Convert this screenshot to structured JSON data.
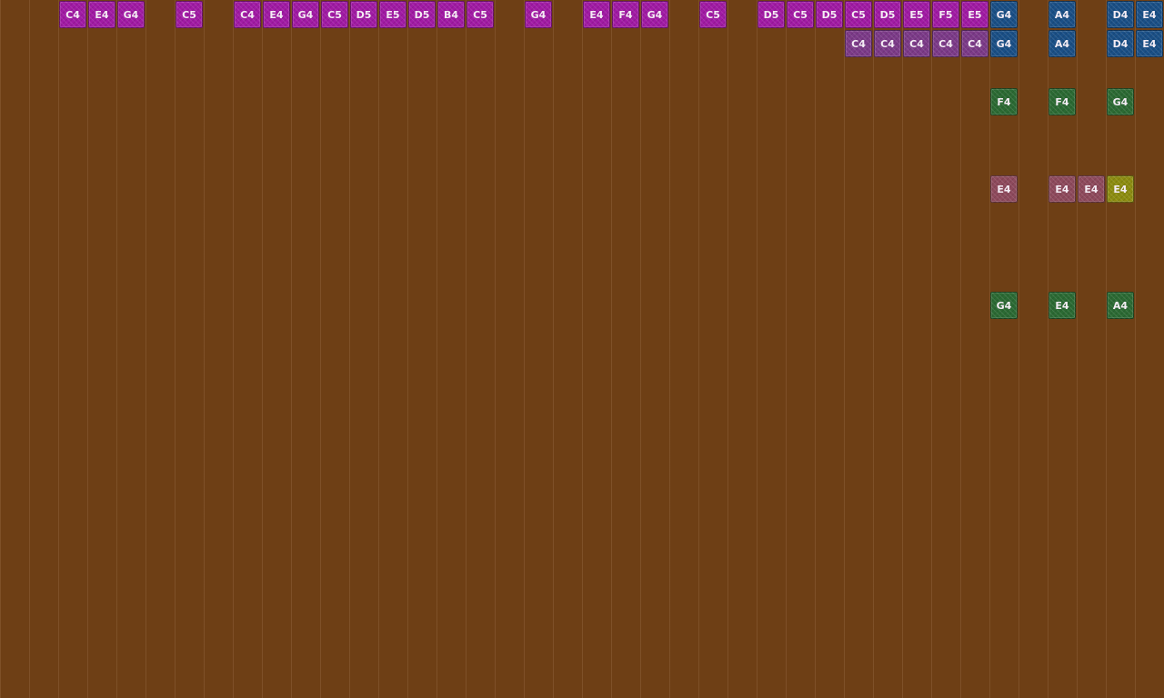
{
  "palette": {
    "background": "#6e3f15",
    "magenta": "#a11aa4",
    "purple": "#7c3a88",
    "blue": "#1a4f86",
    "green": "#2b6a33",
    "rose": "#8e4a5c",
    "olive": "#8c8c10"
  },
  "notes": [
    {
      "label": "C4",
      "color": "magenta",
      "col": 2,
      "row": 0
    },
    {
      "label": "E4",
      "color": "magenta",
      "col": 3,
      "row": 0
    },
    {
      "label": "G4",
      "color": "magenta",
      "col": 4,
      "row": 0
    },
    {
      "label": "C5",
      "color": "magenta",
      "col": 6,
      "row": 0
    },
    {
      "label": "C4",
      "color": "magenta",
      "col": 8,
      "row": 0
    },
    {
      "label": "E4",
      "color": "magenta",
      "col": 9,
      "row": 0
    },
    {
      "label": "G4",
      "color": "magenta",
      "col": 10,
      "row": 0
    },
    {
      "label": "C5",
      "color": "magenta",
      "col": 11,
      "row": 0
    },
    {
      "label": "D5",
      "color": "magenta",
      "col": 12,
      "row": 0
    },
    {
      "label": "E5",
      "color": "magenta",
      "col": 13,
      "row": 0
    },
    {
      "label": "D5",
      "color": "magenta",
      "col": 14,
      "row": 0
    },
    {
      "label": "B4",
      "color": "magenta",
      "col": 15,
      "row": 0
    },
    {
      "label": "C5",
      "color": "magenta",
      "col": 16,
      "row": 0
    },
    {
      "label": "G4",
      "color": "magenta",
      "col": 18,
      "row": 0
    },
    {
      "label": "E4",
      "color": "magenta",
      "col": 20,
      "row": 0
    },
    {
      "label": "F4",
      "color": "magenta",
      "col": 21,
      "row": 0
    },
    {
      "label": "G4",
      "color": "magenta",
      "col": 22,
      "row": 0
    },
    {
      "label": "C5",
      "color": "magenta",
      "col": 24,
      "row": 0
    },
    {
      "label": "D5",
      "color": "magenta",
      "col": 26,
      "row": 0
    },
    {
      "label": "C5",
      "color": "magenta",
      "col": 27,
      "row": 0
    },
    {
      "label": "D5",
      "color": "magenta",
      "col": 28,
      "row": 0
    },
    {
      "label": "C5",
      "color": "magenta",
      "col": 29,
      "row": 0
    },
    {
      "label": "D5",
      "color": "magenta",
      "col": 30,
      "row": 0
    },
    {
      "label": "E5",
      "color": "magenta",
      "col": 31,
      "row": 0
    },
    {
      "label": "F5",
      "color": "magenta",
      "col": 32,
      "row": 0
    },
    {
      "label": "E5",
      "color": "magenta",
      "col": 33,
      "row": 0
    },
    {
      "label": "G4",
      "color": "blue",
      "col": 34,
      "row": 0
    },
    {
      "label": "A4",
      "color": "blue",
      "col": 36,
      "row": 0
    },
    {
      "label": "D4",
      "color": "blue",
      "col": 38,
      "row": 0
    },
    {
      "label": "E4",
      "color": "blue",
      "col": 39,
      "row": 0
    },
    {
      "label": "C4",
      "color": "purple",
      "col": 29,
      "row": 1
    },
    {
      "label": "C4",
      "color": "purple",
      "col": 30,
      "row": 1
    },
    {
      "label": "C4",
      "color": "purple",
      "col": 31,
      "row": 1
    },
    {
      "label": "C4",
      "color": "purple",
      "col": 32,
      "row": 1
    },
    {
      "label": "C4",
      "color": "purple",
      "col": 33,
      "row": 1
    },
    {
      "label": "G4",
      "color": "blue",
      "col": 34,
      "row": 1
    },
    {
      "label": "A4",
      "color": "blue",
      "col": 36,
      "row": 1
    },
    {
      "label": "D4",
      "color": "blue",
      "col": 38,
      "row": 1
    },
    {
      "label": "E4",
      "color": "blue",
      "col": 39,
      "row": 1
    },
    {
      "label": "F4",
      "color": "green",
      "col": 34,
      "row": 3
    },
    {
      "label": "F4",
      "color": "green",
      "col": 36,
      "row": 3
    },
    {
      "label": "G4",
      "color": "green",
      "col": 38,
      "row": 3
    },
    {
      "label": "E4",
      "color": "rose",
      "col": 34,
      "row": 6
    },
    {
      "label": "E4",
      "color": "rose",
      "col": 36,
      "row": 6
    },
    {
      "label": "E4",
      "color": "rose",
      "col": 37,
      "row": 6
    },
    {
      "label": "E4",
      "color": "olive",
      "col": 38,
      "row": 6
    },
    {
      "label": "G4",
      "color": "green",
      "col": 34,
      "row": 10
    },
    {
      "label": "E4",
      "color": "green",
      "col": 36,
      "row": 10
    },
    {
      "label": "A4",
      "color": "green",
      "col": 38,
      "row": 10
    }
  ]
}
